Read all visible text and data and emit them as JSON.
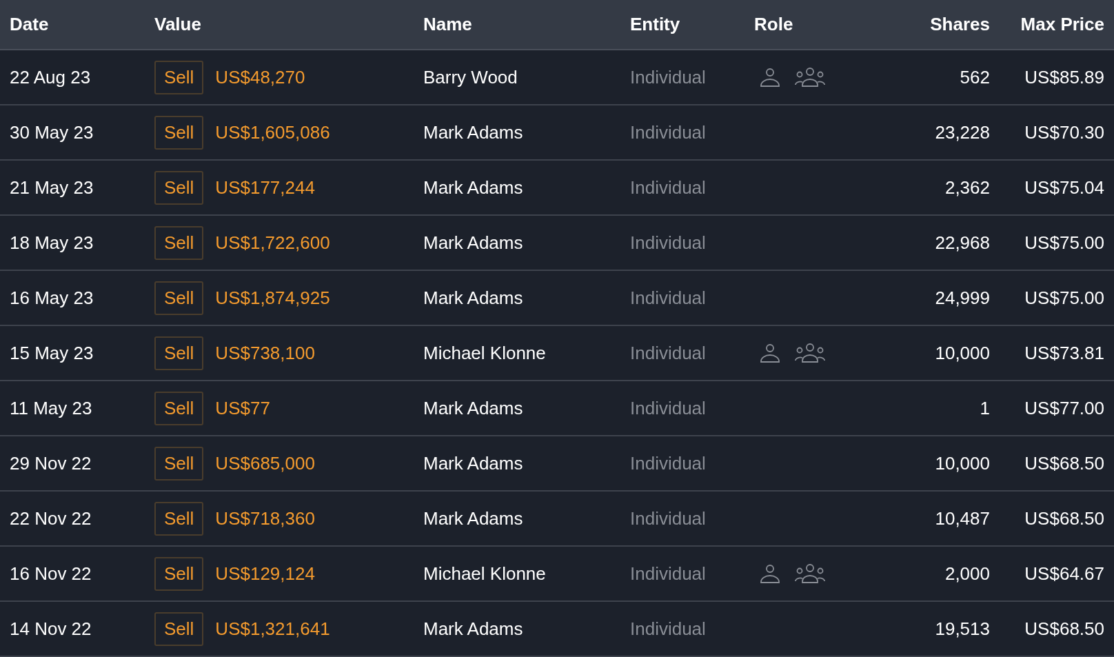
{
  "columns": [
    "Date",
    "Value",
    "Name",
    "Entity",
    "Role",
    "Shares",
    "Max Price"
  ],
  "rows": [
    {
      "date": "22 Aug 23",
      "type": "Sell",
      "value": "US$48,270",
      "name": "Barry Wood",
      "entity": "Individual",
      "roles": [
        {
          "kind": "person"
        },
        {
          "kind": "group"
        }
      ],
      "shares": "562",
      "max_price": "US$85.89"
    },
    {
      "date": "30 May 23",
      "type": "Sell",
      "value": "US$1,605,086",
      "name": "Mark Adams",
      "entity": "Individual",
      "roles": [],
      "shares": "23,228",
      "max_price": "US$70.30"
    },
    {
      "date": "21 May 23",
      "type": "Sell",
      "value": "US$177,244",
      "name": "Mark Adams",
      "entity": "Individual",
      "roles": [],
      "shares": "2,362",
      "max_price": "US$75.04"
    },
    {
      "date": "18 May 23",
      "type": "Sell",
      "value": "US$1,722,600",
      "name": "Mark Adams",
      "entity": "Individual",
      "roles": [],
      "shares": "22,968",
      "max_price": "US$75.00"
    },
    {
      "date": "16 May 23",
      "type": "Sell",
      "value": "US$1,874,925",
      "name": "Mark Adams",
      "entity": "Individual",
      "roles": [],
      "shares": "24,999",
      "max_price": "US$75.00"
    },
    {
      "date": "15 May 23",
      "type": "Sell",
      "value": "US$738,100",
      "name": "Michael Klonne",
      "entity": "Individual",
      "roles": [
        {
          "kind": "person"
        },
        {
          "kind": "group"
        }
      ],
      "shares": "10,000",
      "max_price": "US$73.81"
    },
    {
      "date": "11 May 23",
      "type": "Sell",
      "value": "US$77",
      "name": "Mark Adams",
      "entity": "Individual",
      "roles": [],
      "shares": "1",
      "max_price": "US$77.00"
    },
    {
      "date": "29 Nov 22",
      "type": "Sell",
      "value": "US$685,000",
      "name": "Mark Adams",
      "entity": "Individual",
      "roles": [],
      "shares": "10,000",
      "max_price": "US$68.50"
    },
    {
      "date": "22 Nov 22",
      "type": "Sell",
      "value": "US$718,360",
      "name": "Mark Adams",
      "entity": "Individual",
      "roles": [],
      "shares": "10,487",
      "max_price": "US$68.50"
    },
    {
      "date": "16 Nov 22",
      "type": "Sell",
      "value": "US$129,124",
      "name": "Michael Klonne",
      "entity": "Individual",
      "roles": [
        {
          "kind": "person"
        },
        {
          "kind": "group"
        }
      ],
      "shares": "2,000",
      "max_price": "US$64.67"
    },
    {
      "date": "14 Nov 22",
      "type": "Sell",
      "value": "US$1,321,641",
      "name": "Mark Adams",
      "entity": "Individual",
      "roles": [],
      "shares": "19,513",
      "max_price": "US$68.50"
    }
  ]
}
